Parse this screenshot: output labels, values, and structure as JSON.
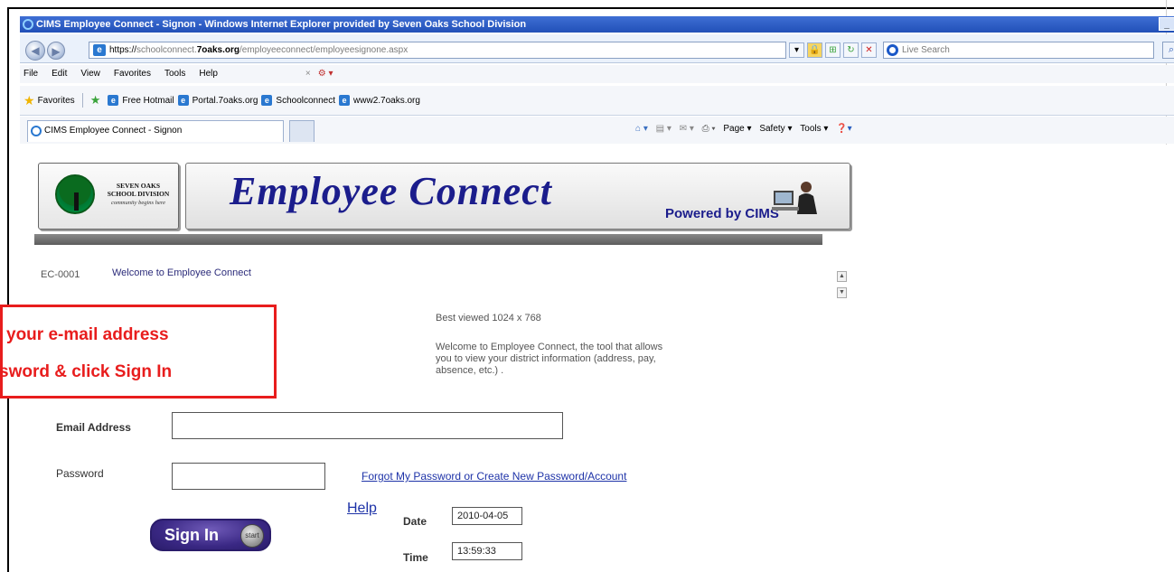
{
  "window": {
    "title": "CIMS Employee Connect - Signon - Windows Internet Explorer provided by Seven Oaks School Division",
    "controls": "_ ",
    "icon": "ie-icon"
  },
  "address": {
    "url_prefix": "https://",
    "url_host_pre": "schoolconnect.",
    "url_host_bold": "7oaks.org",
    "url_path": "/employeeconnect/employeesignone.aspx",
    "search_placeholder": "Live Search"
  },
  "menu": {
    "items": [
      "File",
      "Edit",
      "View",
      "Favorites",
      "Tools",
      "Help"
    ],
    "close": "×"
  },
  "favorites": {
    "label": "Favorites",
    "links": [
      "Free Hotmail",
      "Portal.7oaks.org",
      "Schoolconnect",
      "www2.7oaks.org"
    ]
  },
  "tabs": {
    "active": "CIMS Employee Connect - Signon",
    "commands": [
      "Page ▾",
      "Safety ▾",
      "Tools ▾"
    ]
  },
  "banner": {
    "logo_line1": "SEVEN OAKS",
    "logo_line2": "SCHOOL DIVISION",
    "logo_tagline": "community begins here",
    "title": "Employee Connect",
    "powered_by": "Powered by CIMS"
  },
  "page": {
    "code": "EC-0001",
    "welcome_heading": "Welcome to Employee Connect",
    "best_viewed": "Best viewed 1024 x 768",
    "welcome_text": "Welcome to Employee Connect, the tool that allows you to view your district information (address, pay, absence, etc.) ."
  },
  "callout": {
    "line1": "your e-mail address",
    "line2": "sword & click Sign In"
  },
  "form": {
    "email_label": "Email Address",
    "email_value": "",
    "password_label": "Password",
    "password_value": "",
    "forgot_link": "Forgot My Password or Create New Password/Account",
    "help_link": "Help",
    "date_label": "Date",
    "date_value": "2010-04-05",
    "time_label": "Time",
    "time_value": "13:59:33",
    "signin_label": "Sign In",
    "start_badge": "start"
  },
  "colors": {
    "titlebar": "#2150b8",
    "brand_blue": "#1b1d8c",
    "callout_red": "#e81d1d",
    "link_blue": "#1e33a8",
    "signin_purple": "#3a2884"
  }
}
